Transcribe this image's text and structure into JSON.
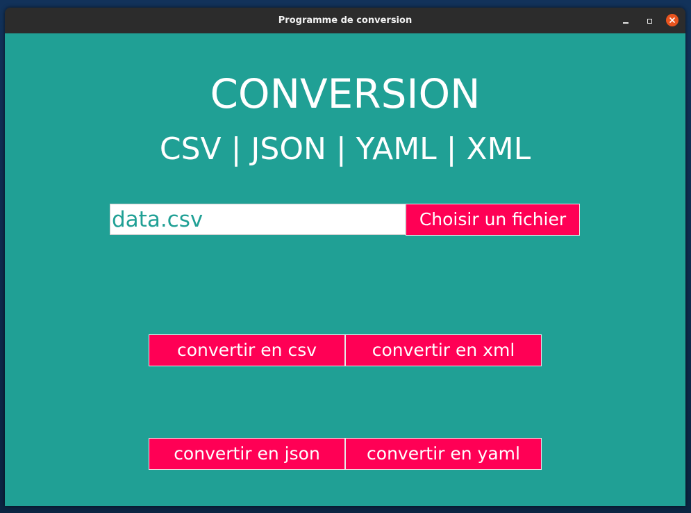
{
  "window": {
    "title": "Programme de conversion"
  },
  "header": {
    "title": "CONVERSION",
    "subtitle": "CSV | JSON | YAML | XML"
  },
  "file": {
    "value": "data.csv",
    "choose_label": "Choisir un fichier"
  },
  "actions": {
    "csv_label": "convertir en csv",
    "xml_label": "convertir en xml",
    "json_label": "convertir en json",
    "yaml_label": "convertir en yaml"
  },
  "colors": {
    "background": "#20a095",
    "button": "#ff0055",
    "titlebar": "#2c2c2c",
    "close": "#e9541e"
  },
  "icons": {
    "minimize": "minimize-icon",
    "maximize": "maximize-icon",
    "close": "close-icon"
  }
}
